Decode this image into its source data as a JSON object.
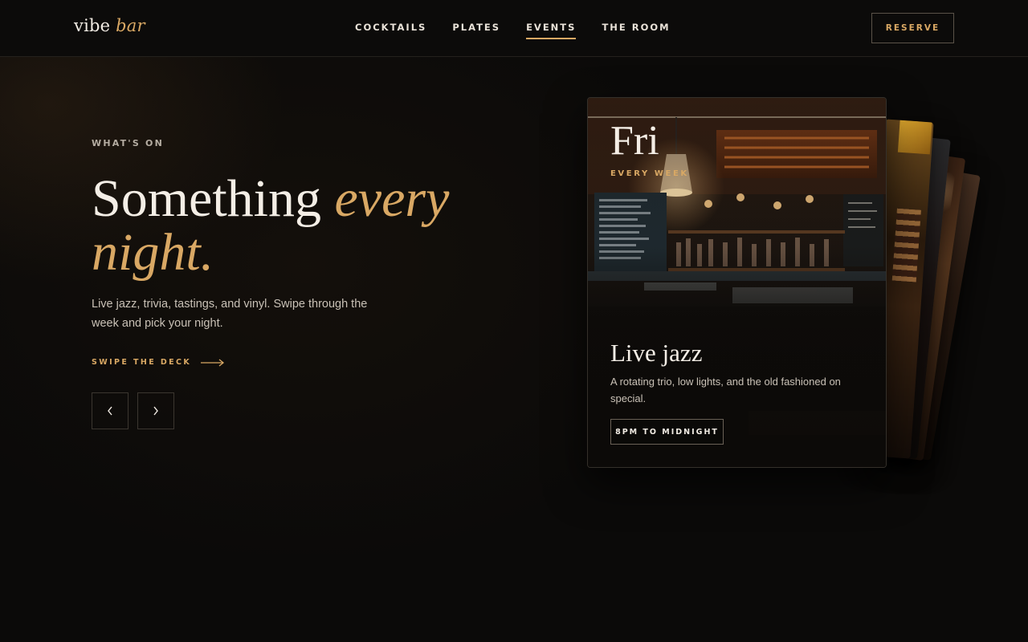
{
  "brand": {
    "name": "vibe",
    "accent": "bar"
  },
  "nav": {
    "items": [
      {
        "label": "COCKTAILS",
        "active": false
      },
      {
        "label": "PLATES",
        "active": false
      },
      {
        "label": "EVENTS",
        "active": true
      },
      {
        "label": "THE ROOM",
        "active": false
      }
    ],
    "reserve_label": "RESERVE"
  },
  "hero": {
    "eyebrow": "WHAT'S ON",
    "headline_plain": "Something",
    "headline_em": "every night.",
    "lede": "Live jazz, trivia, tastings, and vinyl. Swipe through the week and pick your night.",
    "swipe_label": "SWIPE THE DECK"
  },
  "controls": {
    "prev_icon": "chevron-left-icon",
    "next_icon": "chevron-right-icon"
  },
  "card": {
    "day": "Fri",
    "frequency": "EVERY WEEK",
    "title": "Live jazz",
    "description": "A rotating trio, low lights, and the old fashioned on special.",
    "time": "8PM TO MIDNIGHT"
  },
  "colors": {
    "accent": "#d9a864",
    "background": "#0b0a09",
    "text": "#f2ece4",
    "muted": "#c9c1b6"
  }
}
